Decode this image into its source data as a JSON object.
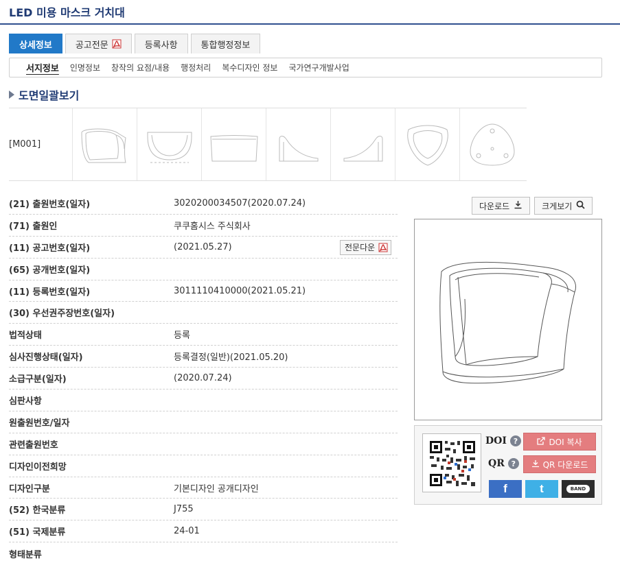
{
  "page": {
    "title": "LED 미용 마스크 거치대"
  },
  "tabs": [
    {
      "label": "상세정보"
    },
    {
      "label": "공고전문"
    },
    {
      "label": "등록사항"
    },
    {
      "label": "통합행정정보"
    }
  ],
  "subtabs": [
    "서지정보",
    "인명정보",
    "창작의 요점/내용",
    "행정처리",
    "복수디자인 정보",
    "국가연구개발사업"
  ],
  "drawings": {
    "heading": "도면일괄보기",
    "label": "[M001]"
  },
  "bib": [
    {
      "key": "(21) 출원번호(일자)",
      "value": "3020200034507(2020.07.24)"
    },
    {
      "key": "(71) 출원인",
      "value": "쿠쿠홈시스 주식회사"
    },
    {
      "key": "(11) 공고번호(일자)",
      "value": "(2021.05.27)",
      "button": "전문다운"
    },
    {
      "key": "(65) 공개번호(일자)",
      "value": ""
    },
    {
      "key": "(11) 등록번호(일자)",
      "value": "3011110410000(2021.05.21)"
    },
    {
      "key": "(30) 우선권주장번호(일자)",
      "value": ""
    },
    {
      "key": "법적상태",
      "value": "등록"
    },
    {
      "key": "심사진행상태(일자)",
      "value": "등록결정(일반)(2021.05.20)"
    },
    {
      "key": "소급구분(일자)",
      "value": "(2020.07.24)"
    },
    {
      "key": "심판사항",
      "value": ""
    },
    {
      "key": "원출원번호/일자",
      "value": ""
    },
    {
      "key": "관련출원번호",
      "value": ""
    },
    {
      "key": "디자인이전희망",
      "value": ""
    },
    {
      "key": "디자인구분",
      "value": "기본디자인 공개디자인"
    },
    {
      "key": "(52) 한국분류",
      "value": "J755"
    },
    {
      "key": "(51) 국제분류",
      "value": "24-01"
    },
    {
      "key": "형태분류",
      "value": ""
    }
  ],
  "viewer": {
    "download": "다운로드",
    "zoom": "크게보기"
  },
  "share": {
    "doi_label": "DOI",
    "qr_label": "QR",
    "doi_button": "DOI 복사",
    "qr_button": "QR 다운로드",
    "facebook": "f",
    "twitter": "t",
    "band": "BAND"
  },
  "colors": {
    "tab_active": "#2179c8",
    "title": "#1f3a73",
    "pink": "#e47d7f",
    "facebook": "#3b6fc4",
    "twitter": "#3fb0e6"
  }
}
